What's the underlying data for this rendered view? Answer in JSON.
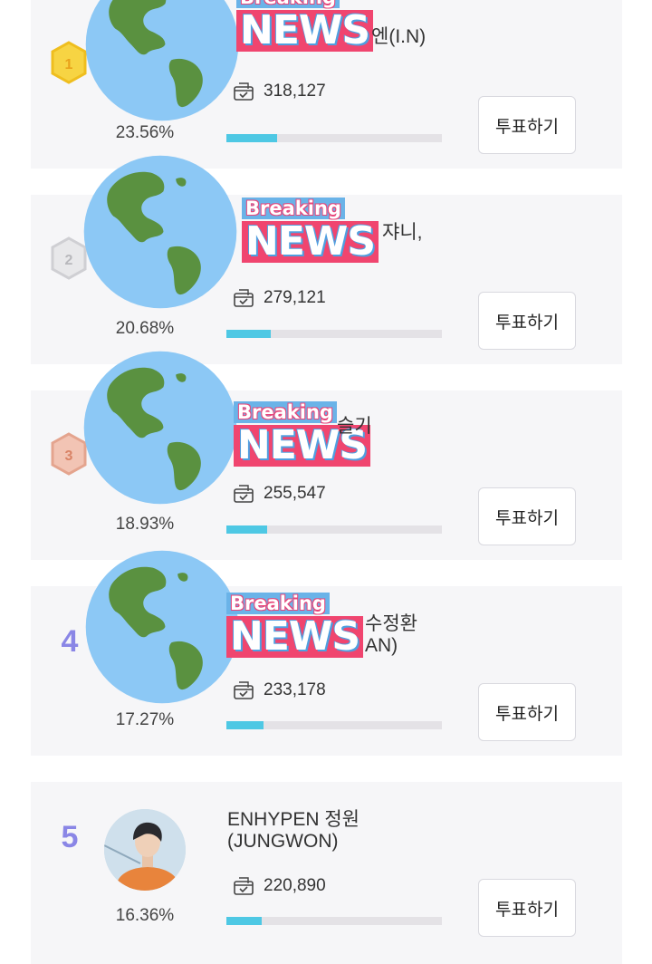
{
  "vote_button_label": "투표하기",
  "sticker": {
    "breaking": "Breaking",
    "news": "NEWS"
  },
  "colors": {
    "accent_rank": "#8a86e6",
    "bar_fill": "#4ec8e4",
    "sticker_pink": "#f0456f",
    "sticker_blue": "#6ab3e8"
  },
  "rankings": [
    {
      "rank": "1",
      "name_line1": "엔(I.N)",
      "name_line2": "",
      "votes": "318,127",
      "percent": "23.56%",
      "share": 0.2356
    },
    {
      "rank": "2",
      "name_line1": "쟈니,",
      "name_line2": "",
      "votes": "279,121",
      "percent": "20.68%",
      "share": 0.2068
    },
    {
      "rank": "3",
      "name_line1": "슬기",
      "name_line2": "",
      "votes": "255,547",
      "percent": "18.93%",
      "share": 0.1893
    },
    {
      "rank": "4",
      "name_line1": "수정환",
      "name_line2": "AN)",
      "votes": "233,178",
      "percent": "17.27%",
      "share": 0.1727
    },
    {
      "rank": "5",
      "name_line1": "ENHYPEN 정원",
      "name_line2": "(JUNGWON)",
      "votes": "220,890",
      "percent": "16.36%",
      "share": 0.1636
    }
  ]
}
